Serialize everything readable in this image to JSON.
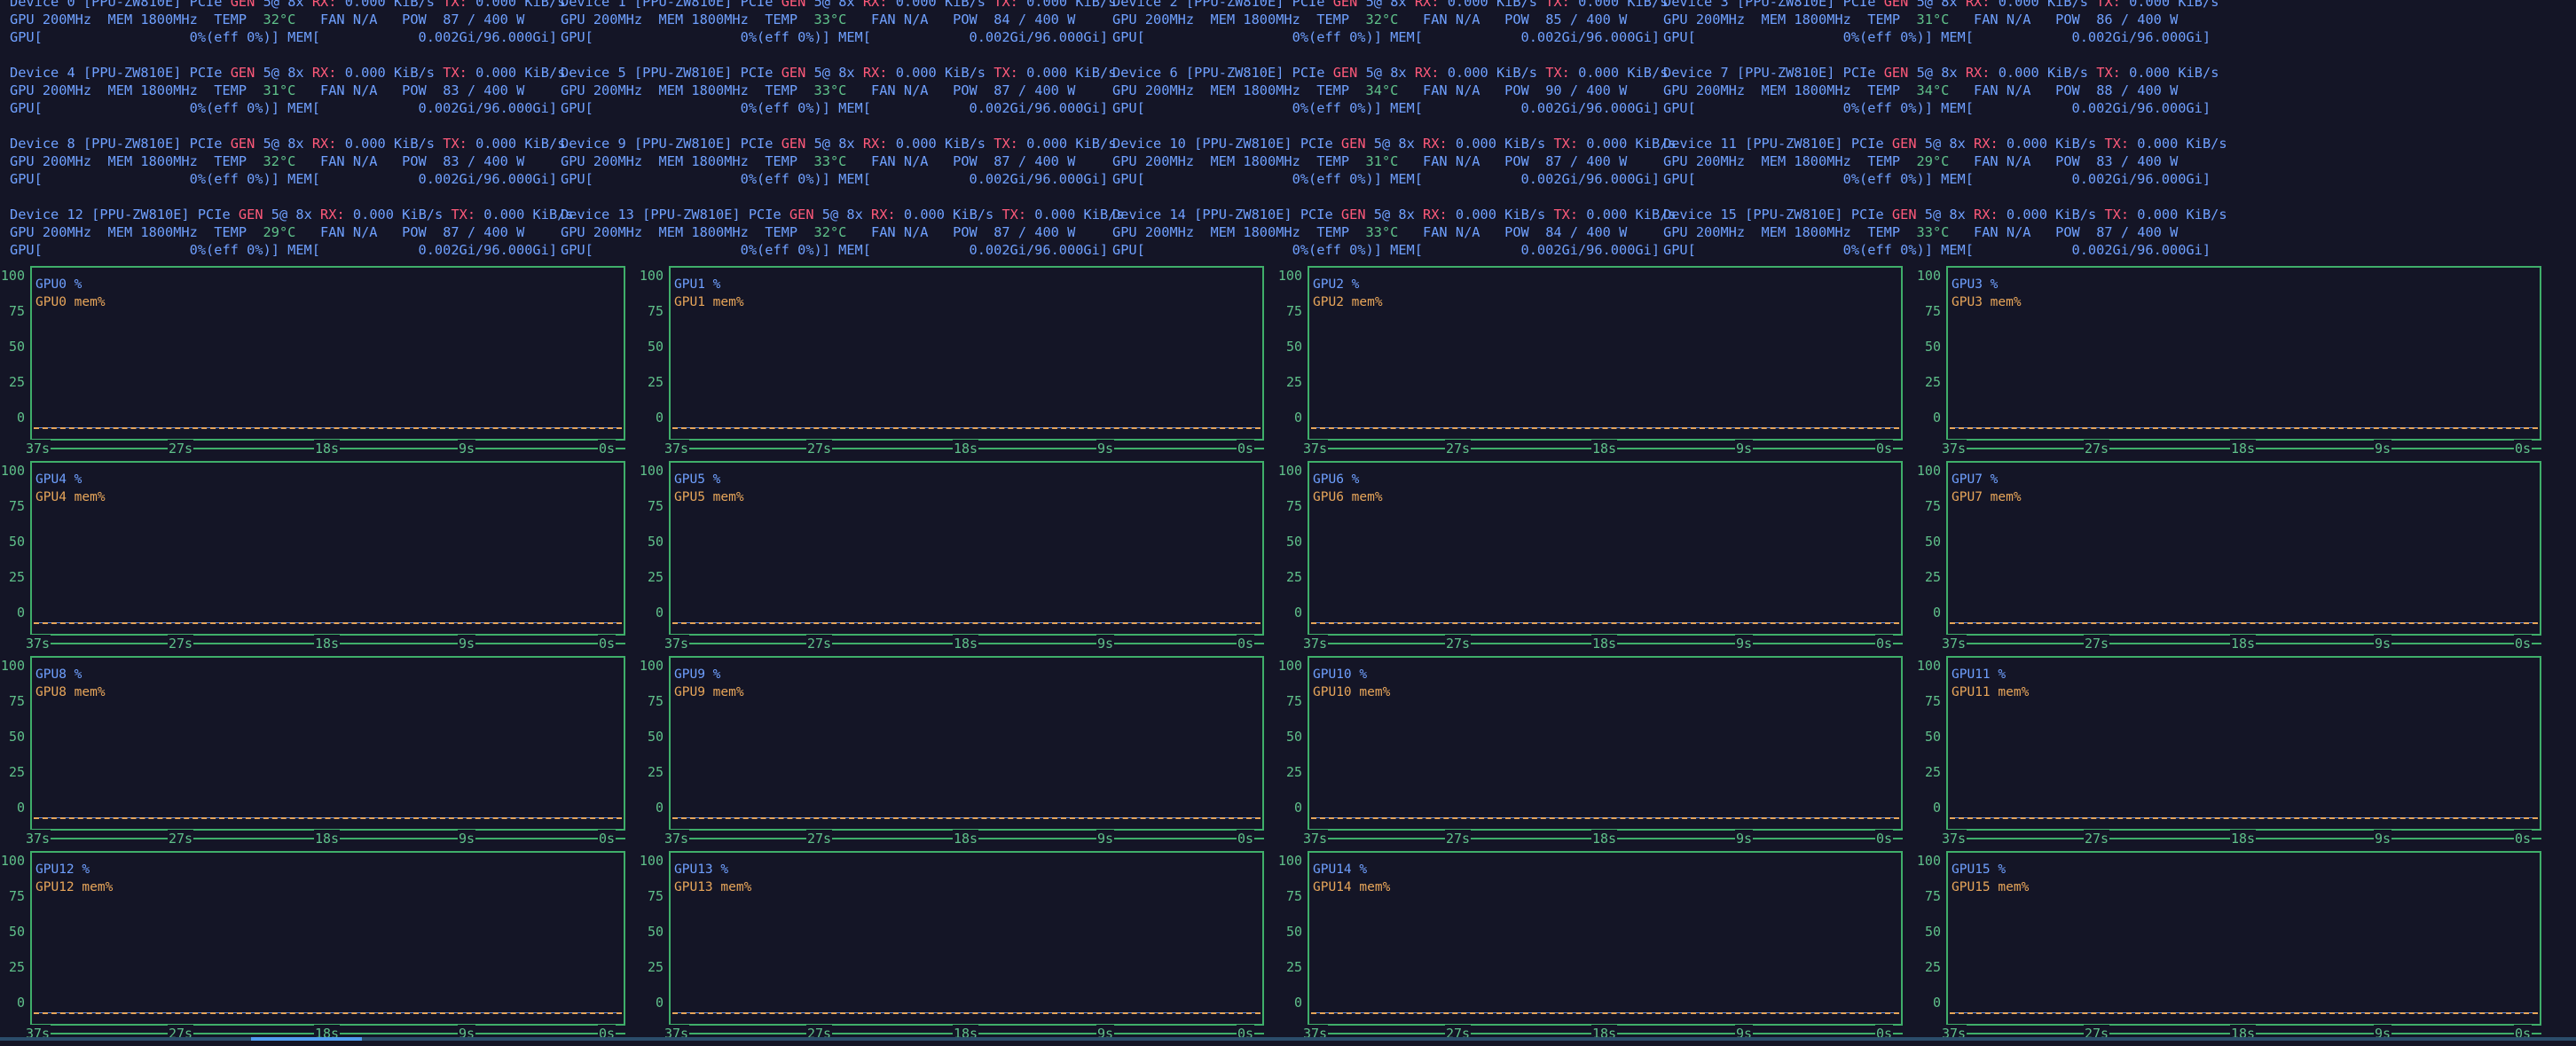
{
  "devices": [
    {
      "label": "Device 0",
      "model": "[PPU-ZW810E]",
      "pcie": "PCIe",
      "gen": "GEN",
      "link": "5@ 8x",
      "rx_label": "RX:",
      "rx": "0.000 KiB/s",
      "tx_label": "TX:",
      "tx": "0.000 KiB/s",
      "gpu_clock": "GPU 200MHz",
      "mem_clock": "MEM 1800MHz",
      "temp_label": "TEMP",
      "temp": "32°C",
      "fan": "FAN N/A",
      "pow_label": "POW",
      "pow": "87 / 400 W",
      "util": "GPU[                  0%(eff 0%)]",
      "mem": "MEM[            0.002Gi/96.000Gi]"
    },
    {
      "label": "Device 1",
      "model": "[PPU-ZW810E]",
      "pcie": "PCIe",
      "gen": "GEN",
      "link": "5@ 8x",
      "rx_label": "RX:",
      "rx": "0.000 KiB/s",
      "tx_label": "TX:",
      "tx": "0.000 KiB/s",
      "gpu_clock": "GPU 200MHz",
      "mem_clock": "MEM 1800MHz",
      "temp_label": "TEMP",
      "temp": "33°C",
      "fan": "FAN N/A",
      "pow_label": "POW",
      "pow": "84 / 400 W",
      "util": "GPU[                  0%(eff 0%)]",
      "mem": "MEM[            0.002Gi/96.000Gi]"
    },
    {
      "label": "Device 2",
      "model": "[PPU-ZW810E]",
      "pcie": "PCIe",
      "gen": "GEN",
      "link": "5@ 8x",
      "rx_label": "RX:",
      "rx": "0.000 KiB/s",
      "tx_label": "TX:",
      "tx": "0.000 KiB/s",
      "gpu_clock": "GPU 200MHz",
      "mem_clock": "MEM 1800MHz",
      "temp_label": "TEMP",
      "temp": "32°C",
      "fan": "FAN N/A",
      "pow_label": "POW",
      "pow": "85 / 400 W",
      "util": "GPU[                  0%(eff 0%)]",
      "mem": "MEM[            0.002Gi/96.000Gi]"
    },
    {
      "label": "Device 3",
      "model": "[PPU-ZW810E]",
      "pcie": "PCIe",
      "gen": "GEN",
      "link": "5@ 8x",
      "rx_label": "RX:",
      "rx": "0.000 KiB/s",
      "tx_label": "TX:",
      "tx": "0.000 KiB/s",
      "gpu_clock": "GPU 200MHz",
      "mem_clock": "MEM 1800MHz",
      "temp_label": "TEMP",
      "temp": "31°C",
      "fan": "FAN N/A",
      "pow_label": "POW",
      "pow": "86 / 400 W",
      "util": "GPU[                  0%(eff 0%)]",
      "mem": "MEM[            0.002Gi/96.000Gi]"
    },
    {
      "label": "Device 4",
      "model": "[PPU-ZW810E]",
      "pcie": "PCIe",
      "gen": "GEN",
      "link": "5@ 8x",
      "rx_label": "RX:",
      "rx": "0.000 KiB/s",
      "tx_label": "TX:",
      "tx": "0.000 KiB/s",
      "gpu_clock": "GPU 200MHz",
      "mem_clock": "MEM 1800MHz",
      "temp_label": "TEMP",
      "temp": "31°C",
      "fan": "FAN N/A",
      "pow_label": "POW",
      "pow": "83 / 400 W",
      "util": "GPU[                  0%(eff 0%)]",
      "mem": "MEM[            0.002Gi/96.000Gi]"
    },
    {
      "label": "Device 5",
      "model": "[PPU-ZW810E]",
      "pcie": "PCIe",
      "gen": "GEN",
      "link": "5@ 8x",
      "rx_label": "RX:",
      "rx": "0.000 KiB/s",
      "tx_label": "TX:",
      "tx": "0.000 KiB/s",
      "gpu_clock": "GPU 200MHz",
      "mem_clock": "MEM 1800MHz",
      "temp_label": "TEMP",
      "temp": "33°C",
      "fan": "FAN N/A",
      "pow_label": "POW",
      "pow": "87 / 400 W",
      "util": "GPU[                  0%(eff 0%)]",
      "mem": "MEM[            0.002Gi/96.000Gi]"
    },
    {
      "label": "Device 6",
      "model": "[PPU-ZW810E]",
      "pcie": "PCIe",
      "gen": "GEN",
      "link": "5@ 8x",
      "rx_label": "RX:",
      "rx": "0.000 KiB/s",
      "tx_label": "TX:",
      "tx": "0.000 KiB/s",
      "gpu_clock": "GPU 200MHz",
      "mem_clock": "MEM 1800MHz",
      "temp_label": "TEMP",
      "temp": "34°C",
      "fan": "FAN N/A",
      "pow_label": "POW",
      "pow": "90 / 400 W",
      "util": "GPU[                  0%(eff 0%)]",
      "mem": "MEM[            0.002Gi/96.000Gi]"
    },
    {
      "label": "Device 7",
      "model": "[PPU-ZW810E]",
      "pcie": "PCIe",
      "gen": "GEN",
      "link": "5@ 8x",
      "rx_label": "RX:",
      "rx": "0.000 KiB/s",
      "tx_label": "TX:",
      "tx": "0.000 KiB/s",
      "gpu_clock": "GPU 200MHz",
      "mem_clock": "MEM 1800MHz",
      "temp_label": "TEMP",
      "temp": "34°C",
      "fan": "FAN N/A",
      "pow_label": "POW",
      "pow": "88 / 400 W",
      "util": "GPU[                  0%(eff 0%)]",
      "mem": "MEM[            0.002Gi/96.000Gi]"
    },
    {
      "label": "Device 8",
      "model": "[PPU-ZW810E]",
      "pcie": "PCIe",
      "gen": "GEN",
      "link": "5@ 8x",
      "rx_label": "RX:",
      "rx": "0.000 KiB/s",
      "tx_label": "TX:",
      "tx": "0.000 KiB/s",
      "gpu_clock": "GPU 200MHz",
      "mem_clock": "MEM 1800MHz",
      "temp_label": "TEMP",
      "temp": "32°C",
      "fan": "FAN N/A",
      "pow_label": "POW",
      "pow": "83 / 400 W",
      "util": "GPU[                  0%(eff 0%)]",
      "mem": "MEM[            0.002Gi/96.000Gi]"
    },
    {
      "label": "Device 9",
      "model": "[PPU-ZW810E]",
      "pcie": "PCIe",
      "gen": "GEN",
      "link": "5@ 8x",
      "rx_label": "RX:",
      "rx": "0.000 KiB/s",
      "tx_label": "TX:",
      "tx": "0.000 KiB/s",
      "gpu_clock": "GPU 200MHz",
      "mem_clock": "MEM 1800MHz",
      "temp_label": "TEMP",
      "temp": "33°C",
      "fan": "FAN N/A",
      "pow_label": "POW",
      "pow": "87 / 400 W",
      "util": "GPU[                  0%(eff 0%)]",
      "mem": "MEM[            0.002Gi/96.000Gi]"
    },
    {
      "label": "Device 10",
      "model": "[PPU-ZW810E]",
      "pcie": "PCIe",
      "gen": "GEN",
      "link": "5@ 8x",
      "rx_label": "RX:",
      "rx": "0.000 KiB/s",
      "tx_label": "TX:",
      "tx": "0.000 KiB/s",
      "gpu_clock": "GPU 200MHz",
      "mem_clock": "MEM 1800MHz",
      "temp_label": "TEMP",
      "temp": "31°C",
      "fan": "FAN N/A",
      "pow_label": "POW",
      "pow": "87 / 400 W",
      "util": "GPU[                  0%(eff 0%)]",
      "mem": "MEM[            0.002Gi/96.000Gi]"
    },
    {
      "label": "Device 11",
      "model": "[PPU-ZW810E]",
      "pcie": "PCIe",
      "gen": "GEN",
      "link": "5@ 8x",
      "rx_label": "RX:",
      "rx": "0.000 KiB/s",
      "tx_label": "TX:",
      "tx": "0.000 KiB/s",
      "gpu_clock": "GPU 200MHz",
      "mem_clock": "MEM 1800MHz",
      "temp_label": "TEMP",
      "temp": "29°C",
      "fan": "FAN N/A",
      "pow_label": "POW",
      "pow": "83 / 400 W",
      "util": "GPU[                  0%(eff 0%)]",
      "mem": "MEM[            0.002Gi/96.000Gi]"
    },
    {
      "label": "Device 12",
      "model": "[PPU-ZW810E]",
      "pcie": "PCIe",
      "gen": "GEN",
      "link": "5@ 8x",
      "rx_label": "RX:",
      "rx": "0.000 KiB/s",
      "tx_label": "TX:",
      "tx": "0.000 KiB/s",
      "gpu_clock": "GPU 200MHz",
      "mem_clock": "MEM 1800MHz",
      "temp_label": "TEMP",
      "temp": "29°C",
      "fan": "FAN N/A",
      "pow_label": "POW",
      "pow": "87 / 400 W",
      "util": "GPU[                  0%(eff 0%)]",
      "mem": "MEM[            0.002Gi/96.000Gi]"
    },
    {
      "label": "Device 13",
      "model": "[PPU-ZW810E]",
      "pcie": "PCIe",
      "gen": "GEN",
      "link": "5@ 8x",
      "rx_label": "RX:",
      "rx": "0.000 KiB/s",
      "tx_label": "TX:",
      "tx": "0.000 KiB/s",
      "gpu_clock": "GPU 200MHz",
      "mem_clock": "MEM 1800MHz",
      "temp_label": "TEMP",
      "temp": "32°C",
      "fan": "FAN N/A",
      "pow_label": "POW",
      "pow": "87 / 400 W",
      "util": "GPU[                  0%(eff 0%)]",
      "mem": "MEM[            0.002Gi/96.000Gi]"
    },
    {
      "label": "Device 14",
      "model": "[PPU-ZW810E]",
      "pcie": "PCIe",
      "gen": "GEN",
      "link": "5@ 8x",
      "rx_label": "RX:",
      "rx": "0.000 KiB/s",
      "tx_label": "TX:",
      "tx": "0.000 KiB/s",
      "gpu_clock": "GPU 200MHz",
      "mem_clock": "MEM 1800MHz",
      "temp_label": "TEMP",
      "temp": "33°C",
      "fan": "FAN N/A",
      "pow_label": "POW",
      "pow": "84 / 400 W",
      "util": "GPU[                  0%(eff 0%)]",
      "mem": "MEM[            0.002Gi/96.000Gi]"
    },
    {
      "label": "Device 15",
      "model": "[PPU-ZW810E]",
      "pcie": "PCIe",
      "gen": "GEN",
      "link": "5@ 8x",
      "rx_label": "RX:",
      "rx": "0.000 KiB/s",
      "tx_label": "TX:",
      "tx": "0.000 KiB/s",
      "gpu_clock": "GPU 200MHz",
      "mem_clock": "MEM 1800MHz",
      "temp_label": "TEMP",
      "temp": "33°C",
      "fan": "FAN N/A",
      "pow_label": "POW",
      "pow": "87 / 400 W",
      "util": "GPU[                  0%(eff 0%)]",
      "mem": "MEM[            0.002Gi/96.000Gi]"
    }
  ],
  "charts": [
    {
      "util_label": "GPU0 %",
      "mem_label": "GPU0 mem%"
    },
    {
      "util_label": "GPU1 %",
      "mem_label": "GPU1 mem%"
    },
    {
      "util_label": "GPU2 %",
      "mem_label": "GPU2 mem%"
    },
    {
      "util_label": "GPU3 %",
      "mem_label": "GPU3 mem%"
    },
    {
      "util_label": "GPU4 %",
      "mem_label": "GPU4 mem%"
    },
    {
      "util_label": "GPU5 %",
      "mem_label": "GPU5 mem%"
    },
    {
      "util_label": "GPU6 %",
      "mem_label": "GPU6 mem%"
    },
    {
      "util_label": "GPU7 %",
      "mem_label": "GPU7 mem%"
    },
    {
      "util_label": "GPU8 %",
      "mem_label": "GPU8 mem%"
    },
    {
      "util_label": "GPU9 %",
      "mem_label": "GPU9 mem%"
    },
    {
      "util_label": "GPU10 %",
      "mem_label": "GPU10 mem%"
    },
    {
      "util_label": "GPU11 %",
      "mem_label": "GPU11 mem%"
    },
    {
      "util_label": "GPU12 %",
      "mem_label": "GPU12 mem%"
    },
    {
      "util_label": "GPU13 %",
      "mem_label": "GPU13 mem%"
    },
    {
      "util_label": "GPU14 %",
      "mem_label": "GPU14 mem%"
    },
    {
      "util_label": "GPU15 %",
      "mem_label": "GPU15 mem%"
    }
  ],
  "chart_axis": {
    "y_ticks": [
      "100",
      "75",
      "50",
      "25",
      "0"
    ],
    "x_ticks": [
      "37s",
      "27s",
      "18s",
      "9s",
      "0s"
    ],
    "util_value": 0,
    "mem_value": 0
  },
  "colors": {
    "background": "#141526",
    "util_line": "#6fa0ff",
    "mem_line": "#e8a65a",
    "frame": "#3fae6a"
  }
}
